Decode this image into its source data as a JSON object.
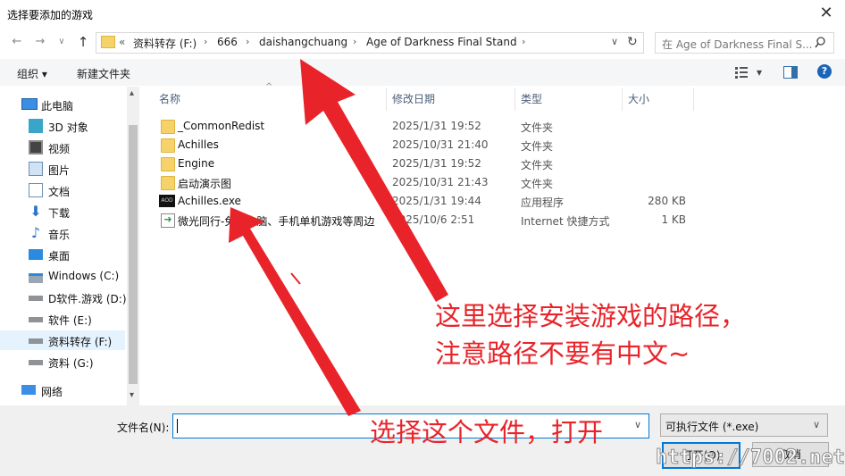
{
  "window": {
    "title": "选择要添加的游戏",
    "close_glyph": "✕"
  },
  "nav": {
    "back": "←",
    "forward": "→",
    "dropdown": "∨",
    "up": "↑",
    "refresh": "↻"
  },
  "address": {
    "overflow": "«",
    "crumbs": [
      "资料转存 (F:)",
      "666",
      "daishangchuang",
      "Age of Darkness Final Stand"
    ],
    "sep": "›",
    "dropdown": "∨"
  },
  "search": {
    "placeholder": "在 Age of Darkness Final S..."
  },
  "toolbar": {
    "organize": "组织 ▾",
    "new_folder": "新建文件夹",
    "view_arrow": "▾",
    "help": "?"
  },
  "sidebar": {
    "items": [
      {
        "label": "此电脑",
        "icon": "computer-icon"
      },
      {
        "label": "3D 对象",
        "icon": "3d-objects-icon"
      },
      {
        "label": "视频",
        "icon": "video-icon"
      },
      {
        "label": "图片",
        "icon": "pictures-icon"
      },
      {
        "label": "文档",
        "icon": "documents-icon"
      },
      {
        "label": "下载",
        "icon": "download-icon"
      },
      {
        "label": "音乐",
        "icon": "music-icon"
      },
      {
        "label": "桌面",
        "icon": "desktop-icon"
      },
      {
        "label": "Windows (C:)",
        "icon": "windows-drive-icon"
      },
      {
        "label": "D软件.游戏 (D:)",
        "icon": "drive-icon"
      },
      {
        "label": "软件 (E:)",
        "icon": "drive-icon"
      },
      {
        "label": "资料转存 (F:)",
        "icon": "drive-icon"
      },
      {
        "label": "资料 (G:)",
        "icon": "drive-icon"
      },
      {
        "label": "网络",
        "icon": "network-icon"
      }
    ],
    "scroll_up": "▴",
    "scroll_down": "▾"
  },
  "columns": {
    "name": "名称",
    "date": "修改日期",
    "type": "类型",
    "size": "大小",
    "sort_glyph": "^"
  },
  "files": [
    {
      "name": "_CommonRedist",
      "date": "2025/1/31 19:52",
      "type": "文件夹",
      "size": "",
      "icon": "folder-icon"
    },
    {
      "name": "Achilles",
      "date": "2025/10/31 21:40",
      "type": "文件夹",
      "size": "",
      "icon": "folder-icon"
    },
    {
      "name": "Engine",
      "date": "2025/1/31 19:52",
      "type": "文件夹",
      "size": "",
      "icon": "folder-icon"
    },
    {
      "name": "启动演示图",
      "date": "2025/10/31 21:43",
      "type": "文件夹",
      "size": "",
      "icon": "folder-icon"
    },
    {
      "name": "Achilles.exe",
      "date": "2025/1/31 19:44",
      "type": "应用程序",
      "size": "280 KB",
      "icon": "exe-icon"
    },
    {
      "name": "微光同行-免费电脑、手机单机游戏等周边",
      "date": "2025/10/6 2:51",
      "type": "Internet 快捷方式",
      "size": "1 KB",
      "icon": "shortcut-icon"
    }
  ],
  "exe_icon_text": "AOD",
  "bottom": {
    "filename_label": "文件名(N):",
    "filename_value": "",
    "filename_dropdown": "∨",
    "filter_value": "可执行文件 (*.exe)",
    "filter_arrow": "∨",
    "open": "打开(O)",
    "cancel": "取消"
  },
  "annotations": {
    "line1": "这里选择安装游戏的路径，",
    "line2": "注意路径不要有中文~",
    "line3": "选择这个文件，打开",
    "color": "#e8242a"
  },
  "watermark": "https://7002.net"
}
